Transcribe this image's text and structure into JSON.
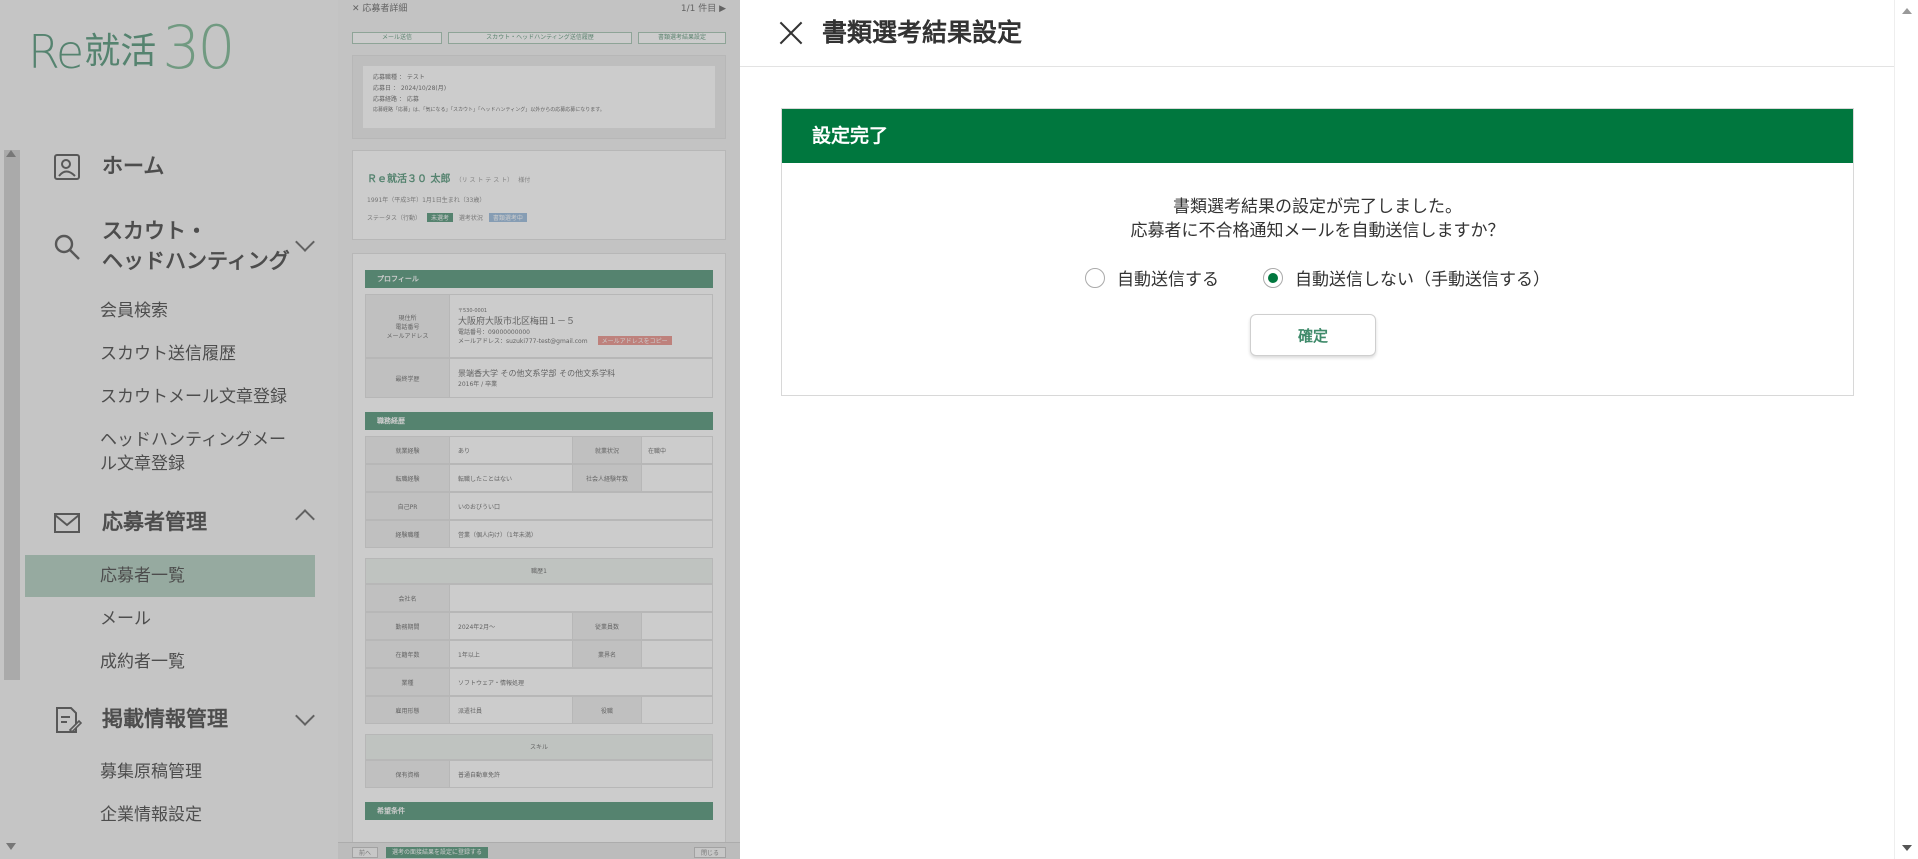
{
  "logo": {
    "re": "Re",
    "kanji": "就活",
    "num": "30"
  },
  "sidebar": {
    "home": "ホーム",
    "scout_line1": "スカウト・",
    "scout_line2": "ヘッドハンティング",
    "scout_items": [
      "会員検索",
      "スカウト送信履歴",
      "スカウトメール文章登録"
    ],
    "hh_line1": "ヘッドハンティングメー",
    "hh_line2": "ル文章登録",
    "applicants": "応募者管理",
    "applicant_items": [
      "応募者一覧",
      "メール",
      "成約者一覧"
    ],
    "listing": "掲載情報管理",
    "listing_items": [
      "募集原稿管理",
      "企業情報設定"
    ]
  },
  "detail": {
    "title": "応募者詳細",
    "header_right": "1/1 件目 ▶",
    "buttons": [
      "メール送信",
      "スカウト・ヘッドハンティング送信履歴",
      "書類選考結果設定"
    ],
    "info_lines": [
      "応募職種 ： テスト",
      "応募日 ： 2024/10/28(月)",
      "応募経路 ： 応募",
      "応募経路「応募」は、「気になる」「スカウト」「ヘッドハンティング」以外からの応募応募になります。"
    ],
    "name": "Ｒｅ就活３０ 太郎",
    "name_kana": "（リ ス ト テ ス ト）",
    "name_suffix": "様付",
    "birth": "1991年（平成3年）1月1日生まれ（33歳）",
    "status_label": "ステータス（行動）",
    "status_tag": "未選考",
    "status_label2": "選考状況",
    "status_tag2": "書類選考中",
    "profile_title": "プロフィール",
    "address_label": "現住所\n電話番号\nメールアドレス",
    "postal": "〒530-0001",
    "address": "大阪府大阪市北区梅田１－５",
    "phone": "電話番号：09000000000",
    "email": "メールアドレス：suzuki777-test@gmail.com",
    "copy_btn": "メールアドレスをコピー",
    "school_label": "最終学歴",
    "school": "景端香大学 その他文系学部 その他文系学科",
    "school_sub": "2016年 / 卒業",
    "career_title": "職務経歴",
    "career_rows": [
      {
        "k": "就業経験",
        "v": "あり",
        "k2": "就業状況",
        "v2": "在職中"
      },
      {
        "k": "転職経験",
        "v": "転職したことはない",
        "k2": "社会人経験年数",
        "v2": ""
      },
      {
        "k": "自己PR",
        "v": "いのおびうい口",
        "k2": "",
        "v2": ""
      },
      {
        "k": "経験職種",
        "v": "営業（個人向け）（1年未満）",
        "k2": "",
        "v2": ""
      }
    ],
    "career1_title": "職歴1",
    "career1_rows": [
      {
        "k": "会社名",
        "v": "",
        "k2": "",
        "v2": ""
      },
      {
        "k": "勤務期間",
        "v": "2024年2月～",
        "k2": "従業員数",
        "v2": ""
      },
      {
        "k": "在籍年数",
        "v": "1年以上",
        "k2": "業界名",
        "v2": ""
      },
      {
        "k": "業種",
        "v": "ソフトウェア・情報処理",
        "k2": "",
        "v2": ""
      },
      {
        "k": "雇用形態",
        "v": "派遣社員",
        "k2": "役職",
        "v2": ""
      }
    ],
    "skill_title": "スキル",
    "skill_rows": [
      {
        "k": "保有資格",
        "v": "普通自動車免許",
        "k2": "",
        "v2": ""
      }
    ],
    "wish_title": "希望条件",
    "footer_left": "前へ",
    "footer_main": "選考の面接結果を設定に登録する",
    "footer_right": "閉じる"
  },
  "panel": {
    "title": "書類選考結果設定",
    "card_title": "設定完了",
    "message_line1": "書類選考結果の設定が完了しました。",
    "message_line2": "応募者に不合格通知メールを自動送信しますか？",
    "option_auto": "自動送信する",
    "option_manual": "自動送信しない（手動送信する）",
    "selected_option": "manual",
    "confirm_label": "確定"
  },
  "colors": {
    "accent_green": "#00773e",
    "brand_green": "#3f8a6a",
    "active_bg": "#a9c9b8"
  }
}
